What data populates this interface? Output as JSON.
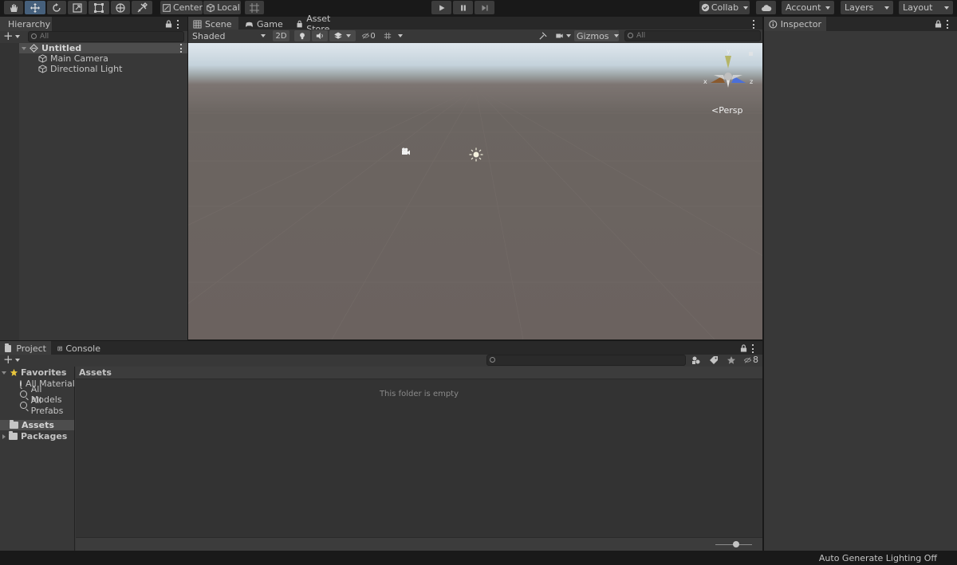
{
  "toolbar": {
    "pivot_label": "Center",
    "space_label": "Local",
    "collab_label": "Collab",
    "account_label": "Account",
    "layers_label": "Layers",
    "layout_label": "Layout"
  },
  "hierarchy": {
    "tab_label": "Hierarchy",
    "search_placeholder": "All",
    "scene_name": "Untitled",
    "items": [
      "Main Camera",
      "Directional Light"
    ]
  },
  "scene_tabs": [
    "Scene",
    "Game",
    "Asset Store"
  ],
  "scene_toolbar": {
    "draw_mode": "Shaded",
    "mode_2d": "2D",
    "hidden_count": "0",
    "gizmos_label": "Gizmos",
    "search_placeholder": "All",
    "persp_label": "Persp",
    "axis_x": "x",
    "axis_y": "y",
    "axis_z": "z"
  },
  "inspector": {
    "tab_label": "Inspector"
  },
  "project": {
    "tabs": [
      "Project",
      "Console"
    ],
    "favorites_label": "Favorites",
    "favorites": [
      "All Materials",
      "All Models",
      "All Prefabs"
    ],
    "roots": [
      "Assets",
      "Packages"
    ],
    "breadcrumb": "Assets",
    "empty_message": "This folder is empty",
    "hidden_count": "8"
  },
  "status_bar": {
    "text": "Auto Generate Lighting Off"
  },
  "colors": {
    "accent": "#46607c",
    "panel": "#383838",
    "selection": "#4d4d4d"
  }
}
